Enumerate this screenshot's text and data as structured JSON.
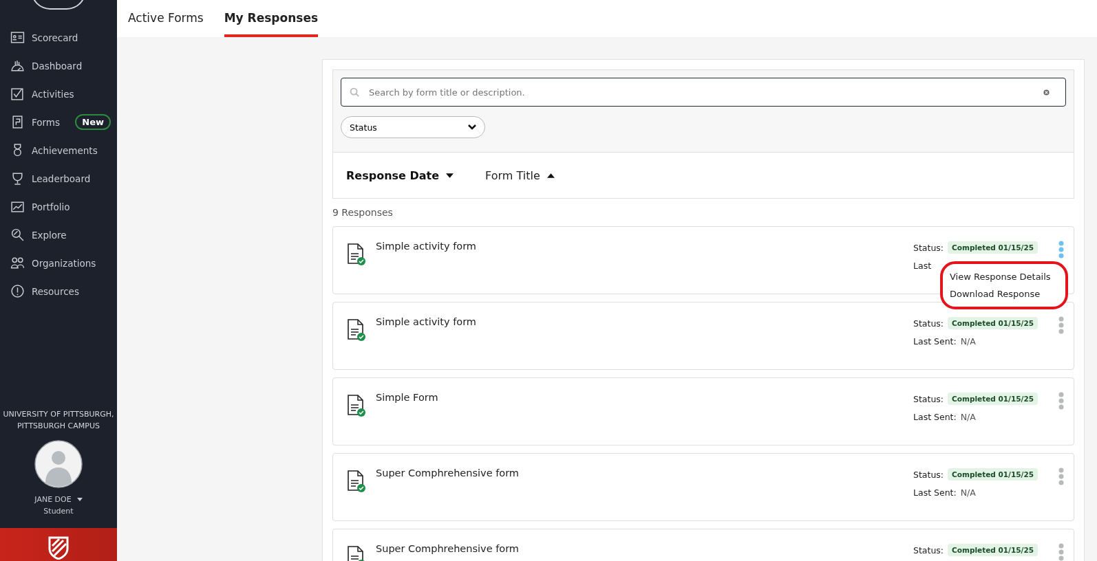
{
  "sidebar": {
    "items": [
      {
        "label": "Scorecard"
      },
      {
        "label": "Dashboard"
      },
      {
        "label": "Activities"
      },
      {
        "label": "Forms",
        "badge": "New"
      },
      {
        "label": "Achievements"
      },
      {
        "label": "Leaderboard"
      },
      {
        "label": "Portfolio"
      },
      {
        "label": "Explore"
      },
      {
        "label": "Organizations"
      },
      {
        "label": "Resources"
      }
    ],
    "institution": [
      "UNIVERSITY OF PITTSBURGH,",
      "PITTSBURGH CAMPUS"
    ],
    "user": {
      "name": "JANE DOE",
      "role": "Student"
    }
  },
  "tabs": [
    {
      "label": "Active Forms",
      "selected": false
    },
    {
      "label": "My Responses",
      "selected": true
    }
  ],
  "search": {
    "placeholder": "Search by form title or description."
  },
  "filter": {
    "label": "Status"
  },
  "sort": [
    {
      "label": "Response Date",
      "active": true,
      "descending": true
    },
    {
      "label": "Form Title",
      "active": false,
      "descending": false
    }
  ],
  "count": "9 Responses",
  "responses": [
    {
      "title": "Simple activity form",
      "status_label": "Status:",
      "status": "Completed 01/15/25",
      "last_sent_label": "Last",
      "menu_open": true,
      "menu": [
        "View Response Details",
        "Download Response"
      ]
    },
    {
      "title": "Simple activity form",
      "status_label": "Status:",
      "status": "Completed 01/15/25",
      "last_sent_label": "Last Sent:",
      "last_sent": "N/A",
      "menu_open": false
    },
    {
      "title": "Simple Form",
      "status_label": "Status:",
      "status": "Completed 01/15/25",
      "last_sent_label": "Last Sent:",
      "last_sent": "N/A",
      "menu_open": false
    },
    {
      "title": "Super Comphrehensive form",
      "status_label": "Status:",
      "status": "Completed 01/15/25",
      "last_sent_label": "Last Sent:",
      "last_sent": "N/A",
      "menu_open": false
    },
    {
      "title": "Super Comphrehensive form",
      "status_label": "Status:",
      "status": "Completed 01/15/25",
      "menu_open": false
    }
  ]
}
